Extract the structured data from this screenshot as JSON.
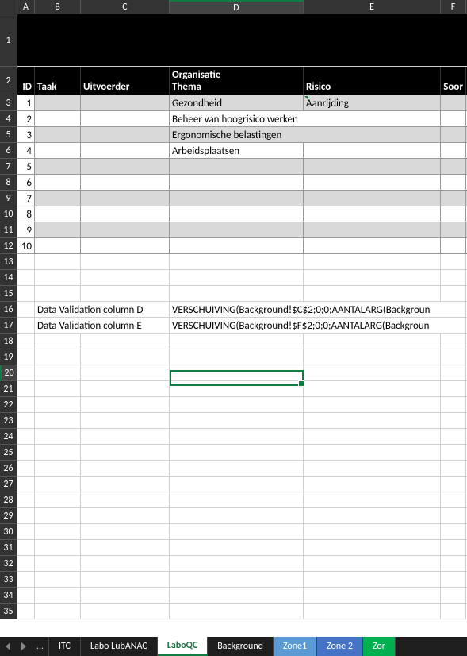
{
  "columns": [
    "A",
    "B",
    "C",
    "D",
    "E",
    "F"
  ],
  "column_widths": {
    "A": 22,
    "B": 58,
    "C": 112,
    "D": 169,
    "E": 173,
    "F": 32
  },
  "selected_column": "D",
  "selected_cell": {
    "col": "D",
    "row": 20
  },
  "headers": {
    "A": "ID",
    "B": "Taak",
    "C": "Uitvoerder",
    "D_line1": "Organisatie",
    "D_line2": "Thema",
    "E": "Risico",
    "F": "Soor"
  },
  "data_rows": [
    {
      "id": "1",
      "d": "Gezondheid",
      "e": "Aanrijding",
      "shaded": true
    },
    {
      "id": "2",
      "d": "Beheer van hoogrisico werken",
      "e": "",
      "shaded": false
    },
    {
      "id": "3",
      "d": "Ergonomische belastingen",
      "e": "",
      "shaded": true
    },
    {
      "id": "4",
      "d": "Arbeidsplaatsen",
      "e": "",
      "shaded": false
    },
    {
      "id": "5",
      "d": "",
      "e": "",
      "shaded": true
    },
    {
      "id": "6",
      "d": "",
      "e": "",
      "shaded": false
    },
    {
      "id": "7",
      "d": "",
      "e": "",
      "shaded": true
    },
    {
      "id": "8",
      "d": "",
      "e": "",
      "shaded": false
    },
    {
      "id": "9",
      "d": "",
      "e": "",
      "shaded": true
    },
    {
      "id": "10",
      "d": "",
      "e": "",
      "shaded": false
    }
  ],
  "validation_rows": {
    "row16": {
      "bc": "Data Validation column D",
      "d": "VERSCHUIVING(Background!$C$2;0;0;AANTALARG(Backgroun"
    },
    "row17": {
      "bc": "Data Validation column E",
      "d": "VERSCHUIVING(Background!$F$2;0;0;AANTALARG(Backgroun"
    }
  },
  "blank_rows_after": [
    13,
    14,
    15,
    18,
    19,
    20,
    21,
    22,
    23,
    24,
    25,
    26,
    27,
    28,
    29,
    30,
    31,
    32,
    33,
    34,
    35
  ],
  "tabs": [
    {
      "label": "ITC",
      "class": ""
    },
    {
      "label": "Labo LubANAC",
      "class": ""
    },
    {
      "label": "LaboQC",
      "class": "active"
    },
    {
      "label": "Background",
      "class": ""
    },
    {
      "label": "Zone1",
      "class": "zone1"
    },
    {
      "label": "Zone 2",
      "class": "zone2"
    },
    {
      "label": "Zor",
      "class": "zone-g"
    }
  ],
  "ellipsis": "...",
  "nav_left": "◀",
  "nav_right": "▶"
}
